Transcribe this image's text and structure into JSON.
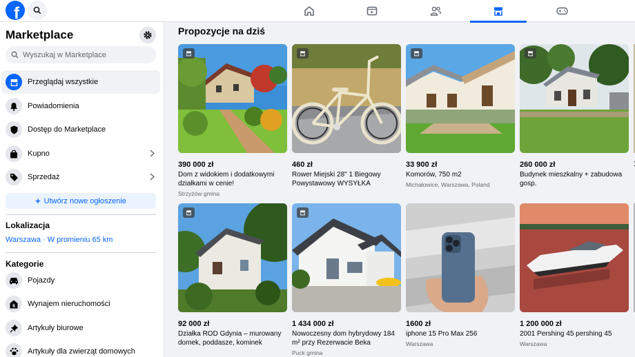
{
  "topbar": {
    "logo": "f",
    "tabs": [
      {
        "name": "home-icon",
        "active": false
      },
      {
        "name": "video-icon",
        "active": false
      },
      {
        "name": "friends-icon",
        "active": false
      },
      {
        "name": "marketplace-icon",
        "active": true
      },
      {
        "name": "gaming-icon",
        "active": false
      }
    ]
  },
  "sidebar": {
    "title": "Marketplace",
    "search_placeholder": "Wyszukaj w Marketplace",
    "items": [
      {
        "label": "Przeglądaj wszystkie",
        "icon": "storefront-icon",
        "active": true
      },
      {
        "label": "Powiadomienia",
        "icon": "bell-icon"
      },
      {
        "label": "Dostęp do Marketplace",
        "icon": "shield-icon"
      },
      {
        "label": "Kupno",
        "icon": "bag-icon"
      },
      {
        "label": "Sprzedaż",
        "icon": "tag-icon"
      }
    ],
    "create_label": "Utwórz nowe ogłoszenie",
    "location_heading": "Lokalizacja",
    "location_value": "Warszawa · W promieniu 65 km",
    "categories_heading": "Kategorie",
    "categories": [
      {
        "label": "Pojazdy",
        "icon": "car-icon"
      },
      {
        "label": "Wynajem nieruchomości",
        "icon": "house-dollar-icon"
      },
      {
        "label": "Artykuły biurowe",
        "icon": "pin-icon"
      },
      {
        "label": "Artykuły dla zwierząt domowych",
        "icon": "paw-icon"
      }
    ]
  },
  "main": {
    "title": "Propozycje na dziś",
    "listings": [
      {
        "price": "390 000 zł",
        "title": "Dom z widokiem i dodatkowymi działkami w cenie!",
        "location": "Strzyżów gmina"
      },
      {
        "price": "460 zł",
        "title": "Rower Miejski 28\" 1 Biegowy Powystawowy WYSYŁKA",
        "location": ""
      },
      {
        "price": "33 900 zł",
        "title": "Komorów, 750 m2",
        "location": "Michałowice, Warszawa, Poland"
      },
      {
        "price": "260 000 zł",
        "title": "Budynek mieszkalny + zabudowa gosp.",
        "location": ""
      },
      {
        "price": "92 000 zł",
        "title": "Działka ROD Gdynia – murowany domek, poddasze, kominek",
        "location": ""
      },
      {
        "price": "1 434 000 zł",
        "title": "Nowoczesny dom hybrydowy 184 m² przy Rezerwacie Beka",
        "location": "Puck gmina"
      },
      {
        "price": "1600 zł",
        "title": "iphone 15 Pro Max 256",
        "location": "Warszawa"
      },
      {
        "price": "1 200 000 zł",
        "title": "2001 Pershing 45 pershing 45",
        "location": "Warszawa"
      }
    ],
    "partial_price": "1"
  }
}
